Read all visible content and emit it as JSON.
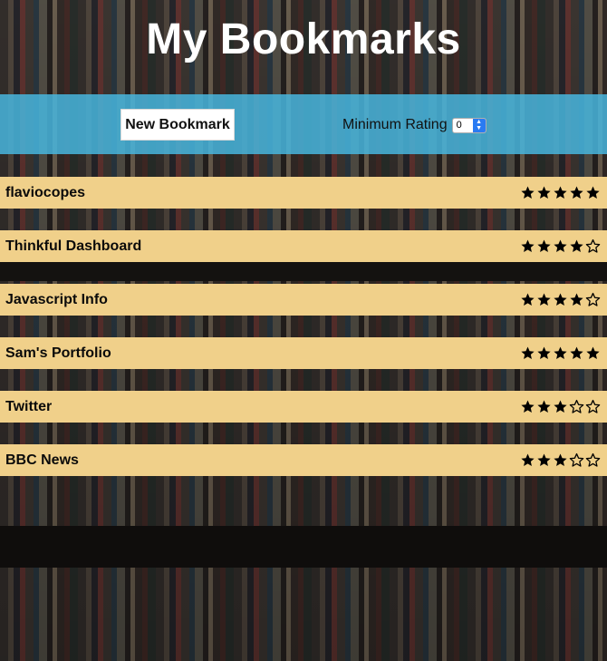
{
  "header": {
    "title": "My Bookmarks"
  },
  "toolbar": {
    "new_bookmark_label": "New Bookmark",
    "min_rating_label": "Minimum Rating",
    "min_rating_value": "0"
  },
  "colors": {
    "toolbar_bg": "#48b6de",
    "bookmark_bg": "#f0d08a",
    "select_accent": "#2a7bf2"
  },
  "icons": {
    "filled_star": "star-filled-icon",
    "empty_star": "star-empty-icon"
  },
  "bookmarks": [
    {
      "title": "flaviocopes",
      "rating": 5,
      "max_rating": 5
    },
    {
      "title": "Thinkful Dashboard",
      "rating": 4,
      "max_rating": 5
    },
    {
      "title": "Javascript Info",
      "rating": 4,
      "max_rating": 5
    },
    {
      "title": "Sam's Portfolio",
      "rating": 5,
      "max_rating": 5
    },
    {
      "title": "Twitter",
      "rating": 3,
      "max_rating": 5
    },
    {
      "title": "BBC News",
      "rating": 3,
      "max_rating": 5
    }
  ]
}
